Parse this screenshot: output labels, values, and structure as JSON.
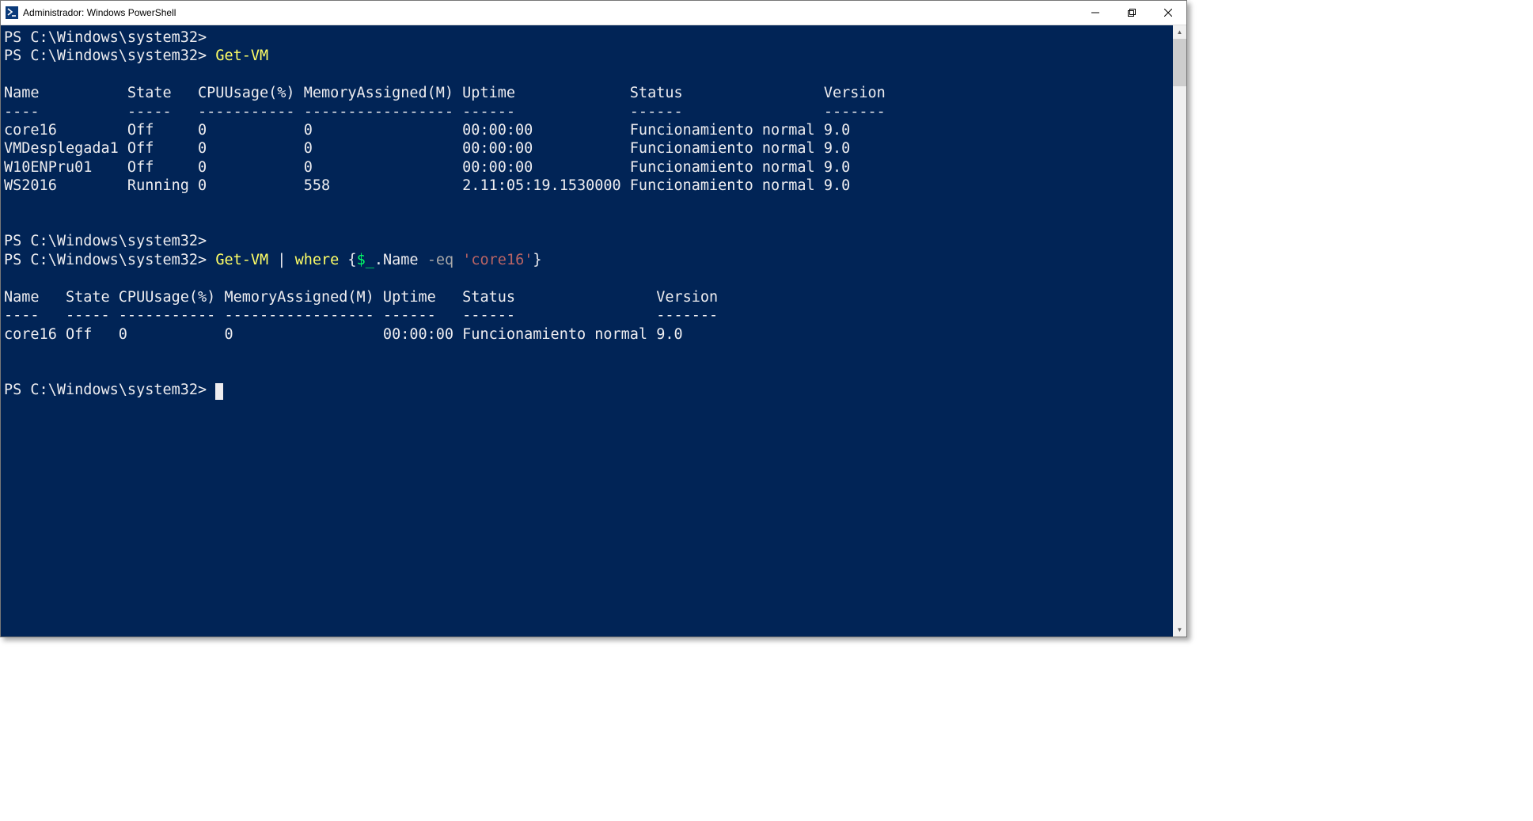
{
  "window": {
    "title": "Administrador: Windows PowerShell"
  },
  "prompt": "PS C:\\Windows\\system32>",
  "cmd1": {
    "cmdlet": "Get-VM"
  },
  "table1": {
    "headers": {
      "name": "Name",
      "state": "State",
      "cpu": "CPUUsage(%)",
      "mem": "MemoryAssigned(M)",
      "uptime": "Uptime",
      "status": "Status",
      "ver": "Version"
    },
    "divs": {
      "name": "----",
      "state": "-----",
      "cpu": "-----------",
      "mem": "-----------------",
      "uptime": "------",
      "status": "------",
      "ver": "-------"
    },
    "rows": [
      {
        "name": "core16",
        "state": "Off",
        "cpu": "0",
        "mem": "0",
        "uptime": "00:00:00",
        "status": "Funcionamiento normal",
        "ver": "9.0"
      },
      {
        "name": "VMDesplegada1",
        "state": "Off",
        "cpu": "0",
        "mem": "0",
        "uptime": "00:00:00",
        "status": "Funcionamiento normal",
        "ver": "9.0"
      },
      {
        "name": "W10ENPru01",
        "state": "Off",
        "cpu": "0",
        "mem": "0",
        "uptime": "00:00:00",
        "status": "Funcionamiento normal",
        "ver": "9.0"
      },
      {
        "name": "WS2016",
        "state": "Running",
        "cpu": "0",
        "mem": "558",
        "uptime": "2.11:05:19.1530000",
        "status": "Funcionamiento normal",
        "ver": "9.0"
      }
    ],
    "col_widths": {
      "name": 14,
      "state": 8,
      "cpu": 12,
      "mem": 18,
      "uptime": 19,
      "status": 22,
      "ver": 7
    }
  },
  "cmd2": {
    "cmdlet": "Get-VM",
    "pipe": "|",
    "where": "where",
    "brace_open": "{",
    "var": "$_",
    "member": ".Name",
    "op": "-eq",
    "str": "'core16'",
    "brace_close": "}"
  },
  "table2": {
    "headers": {
      "name": "Name",
      "state": "State",
      "cpu": "CPUUsage(%)",
      "mem": "MemoryAssigned(M)",
      "uptime": "Uptime",
      "status": "Status",
      "ver": "Version"
    },
    "divs": {
      "name": "----",
      "state": "-----",
      "cpu": "-----------",
      "mem": "-----------------",
      "uptime": "------",
      "status": "------",
      "ver": "-------"
    },
    "rows": [
      {
        "name": "core16",
        "state": "Off",
        "cpu": "0",
        "mem": "0",
        "uptime": "00:00:00",
        "status": "Funcionamiento normal",
        "ver": "9.0"
      }
    ],
    "col_widths": {
      "name": 7,
      "state": 6,
      "cpu": 12,
      "mem": 18,
      "uptime": 9,
      "status": 22,
      "ver": 7
    }
  }
}
